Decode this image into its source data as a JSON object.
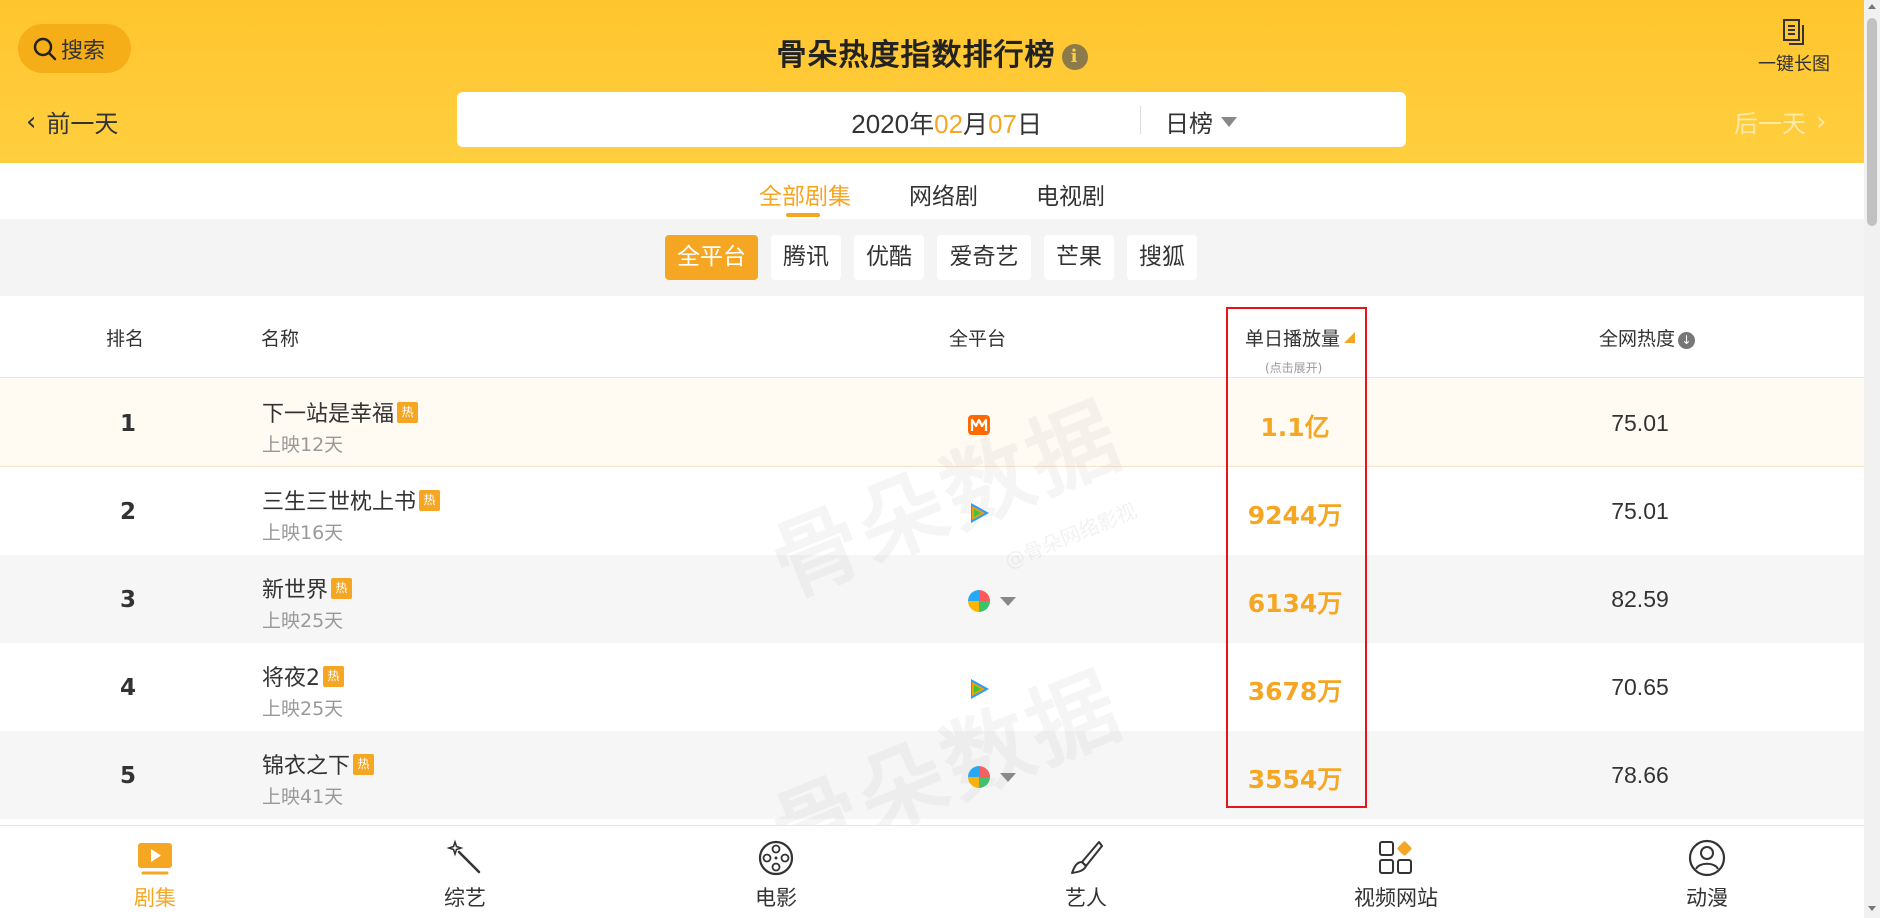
{
  "header": {
    "search_label": "搜索",
    "title": "骨朵热度指数排行榜",
    "info_icon": "i",
    "long_pic_label": "一键长图",
    "prev_day": "前一天",
    "next_day": "后一天",
    "date": {
      "year": "2020",
      "year_unit": "年",
      "month": "02",
      "month_unit": "月",
      "day": "07",
      "day_unit": "日"
    },
    "rank_type": "日榜"
  },
  "category_tabs": [
    "全部剧集",
    "网络剧",
    "电视剧"
  ],
  "platforms": [
    "全平台",
    "腾讯",
    "优酷",
    "爱奇艺",
    "芒果",
    "搜狐"
  ],
  "table": {
    "headers": {
      "rank": "排名",
      "name": "名称",
      "platform": "全平台",
      "plays": "单日播放量",
      "plays_sub": "(点击展开)",
      "heat": "全网热度"
    },
    "hot_badge": "热",
    "rows": [
      {
        "rank": "1",
        "title": "下一站是幸福",
        "days": "上映12天",
        "platform_icon": "mango-icon",
        "plays": "1.1亿",
        "heat": "75.01"
      },
      {
        "rank": "2",
        "title": "三生三世枕上书",
        "days": "上映16天",
        "platform_icon": "tencent-icon",
        "plays": "9244万",
        "heat": "75.01"
      },
      {
        "rank": "3",
        "title": "新世界",
        "days": "上映25天",
        "platform_icon": "multi-platform-icon",
        "plays": "6134万",
        "heat": "82.59"
      },
      {
        "rank": "4",
        "title": "将夜2",
        "days": "上映25天",
        "platform_icon": "tencent-icon",
        "plays": "3678万",
        "heat": "70.65"
      },
      {
        "rank": "5",
        "title": "锦衣之下",
        "days": "上映41天",
        "platform_icon": "multi-platform-icon",
        "plays": "3554万",
        "heat": "78.66"
      }
    ]
  },
  "watermark": {
    "text": "骨朵数据",
    "sub": "@骨朵网络影视"
  },
  "bottom_nav": [
    "剧集",
    "综艺",
    "电影",
    "艺人",
    "视频网站",
    "动漫"
  ],
  "colors": {
    "brand_yellow": "#ffc52e",
    "accent_orange": "#f5a623",
    "highlight_red": "#e8141c"
  }
}
